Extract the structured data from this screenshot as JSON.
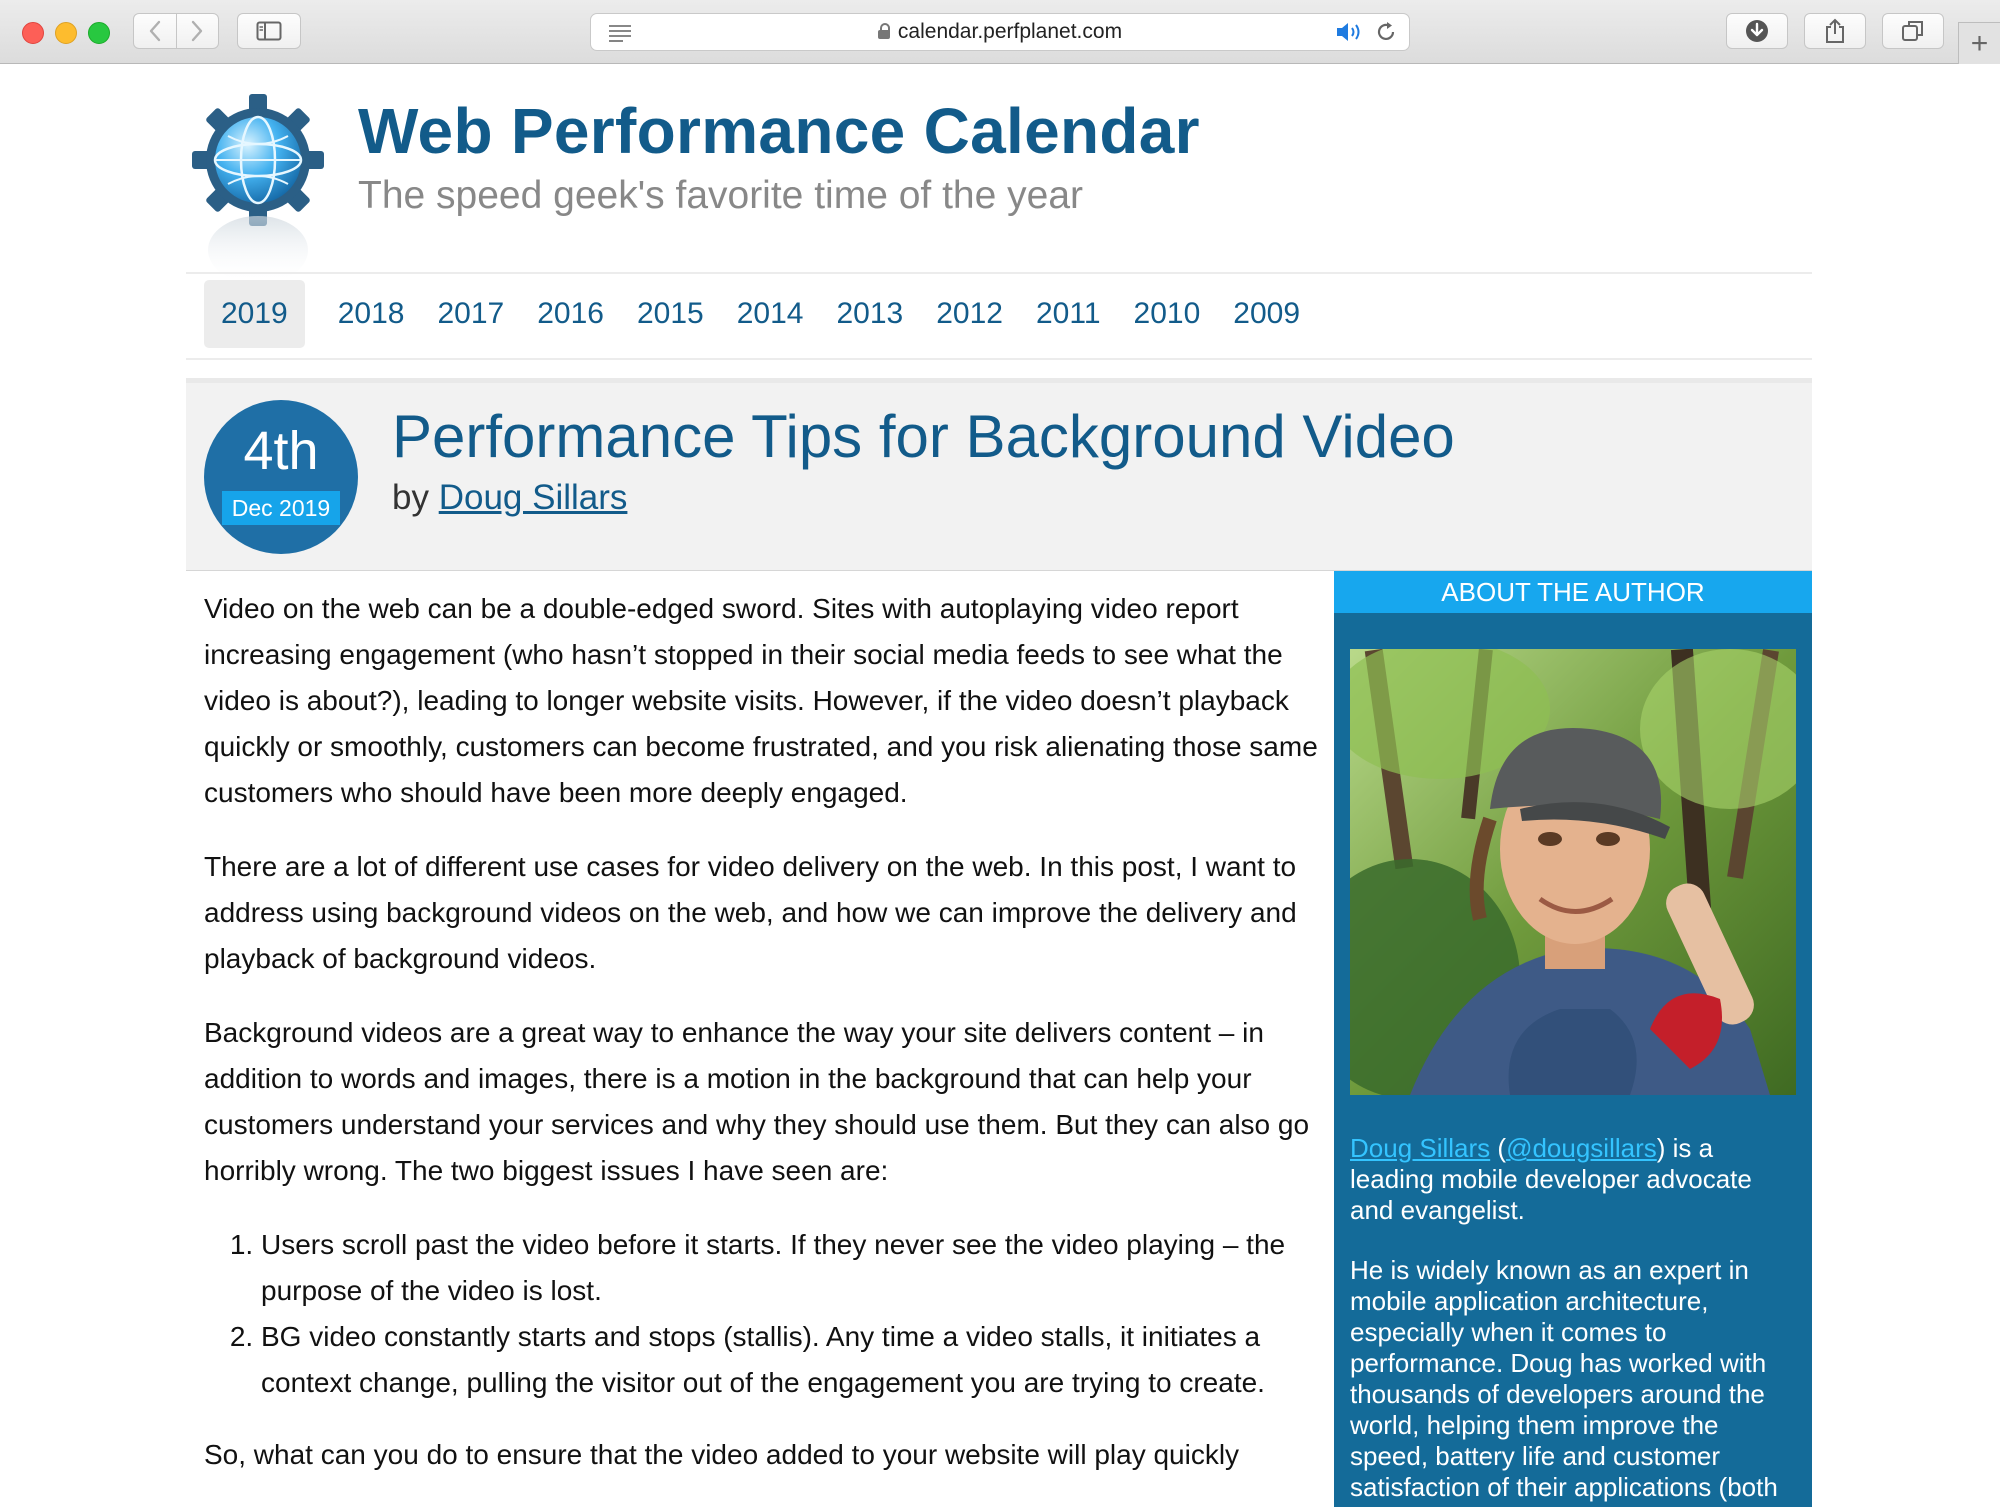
{
  "browser": {
    "url": "calendar.perfplanet.com",
    "icons": [
      "back-icon",
      "forward-icon",
      "sidebar-icon",
      "reader-icon",
      "lock-icon",
      "audio-icon",
      "reload-icon",
      "download-icon",
      "share-icon",
      "tabs-icon",
      "plus-icon"
    ],
    "new_tab_label": "+"
  },
  "site": {
    "title": "Web Performance Calendar",
    "tagline": "The speed geek's favorite time of the year",
    "brand_color": "#125b8a"
  },
  "years": {
    "active": "2019",
    "items": [
      "2018",
      "2017",
      "2016",
      "2015",
      "2014",
      "2013",
      "2012",
      "2011",
      "2010",
      "2009"
    ]
  },
  "post": {
    "date_day": "4th",
    "date_month": "Dec 2019",
    "title": "Performance Tips for Background Video",
    "by": "by",
    "author": "Doug Sillars",
    "paragraphs": [
      "Video on the web can be a double-edged sword. Sites with autoplaying video report increasing engagement (who hasn’t stopped in their social media feeds to see what the video is about?), leading to longer website visits. However, if the video doesn’t playback quickly or smoothly, customers can become frustrated, and you risk alienating those same customers who should have been more deeply engaged.",
      "There are a lot of different use cases for video delivery on the web. In this post, I want to address using background videos on the web, and how we can improve the delivery and playback of background videos.",
      "Background videos are a great way to enhance the way your site delivers content – in addition to words and images, there is a motion in the background that can help your customers understand your services and why they should use them. But they can also go horribly wrong. The two biggest issues I have seen are:"
    ],
    "list": [
      "Users scroll past the video before it starts. If they never see the video playing – the purpose of the video is lost.",
      "BG video constantly starts and stops (stallis). Any time a video stalls, it initiates a context change, pulling the visitor out of the engagement you are trying to create."
    ],
    "trailing": "So, what can you do to ensure that the video added to your website will play quickly"
  },
  "sidebar": {
    "heading": "ABOUT THE AUTHOR",
    "author_link": "Doug Sillars",
    "handle_open": " (",
    "handle": "@dougsillars",
    "bio_first": ") is a leading mobile developer advocate and evangelist.",
    "bio_second": "He is widely known as an expert in mobile application architecture, especially when it comes to performance. Doug has worked with thousands of developers around the world, helping them improve the speed, battery life and customer satisfaction of their applications (both"
  }
}
